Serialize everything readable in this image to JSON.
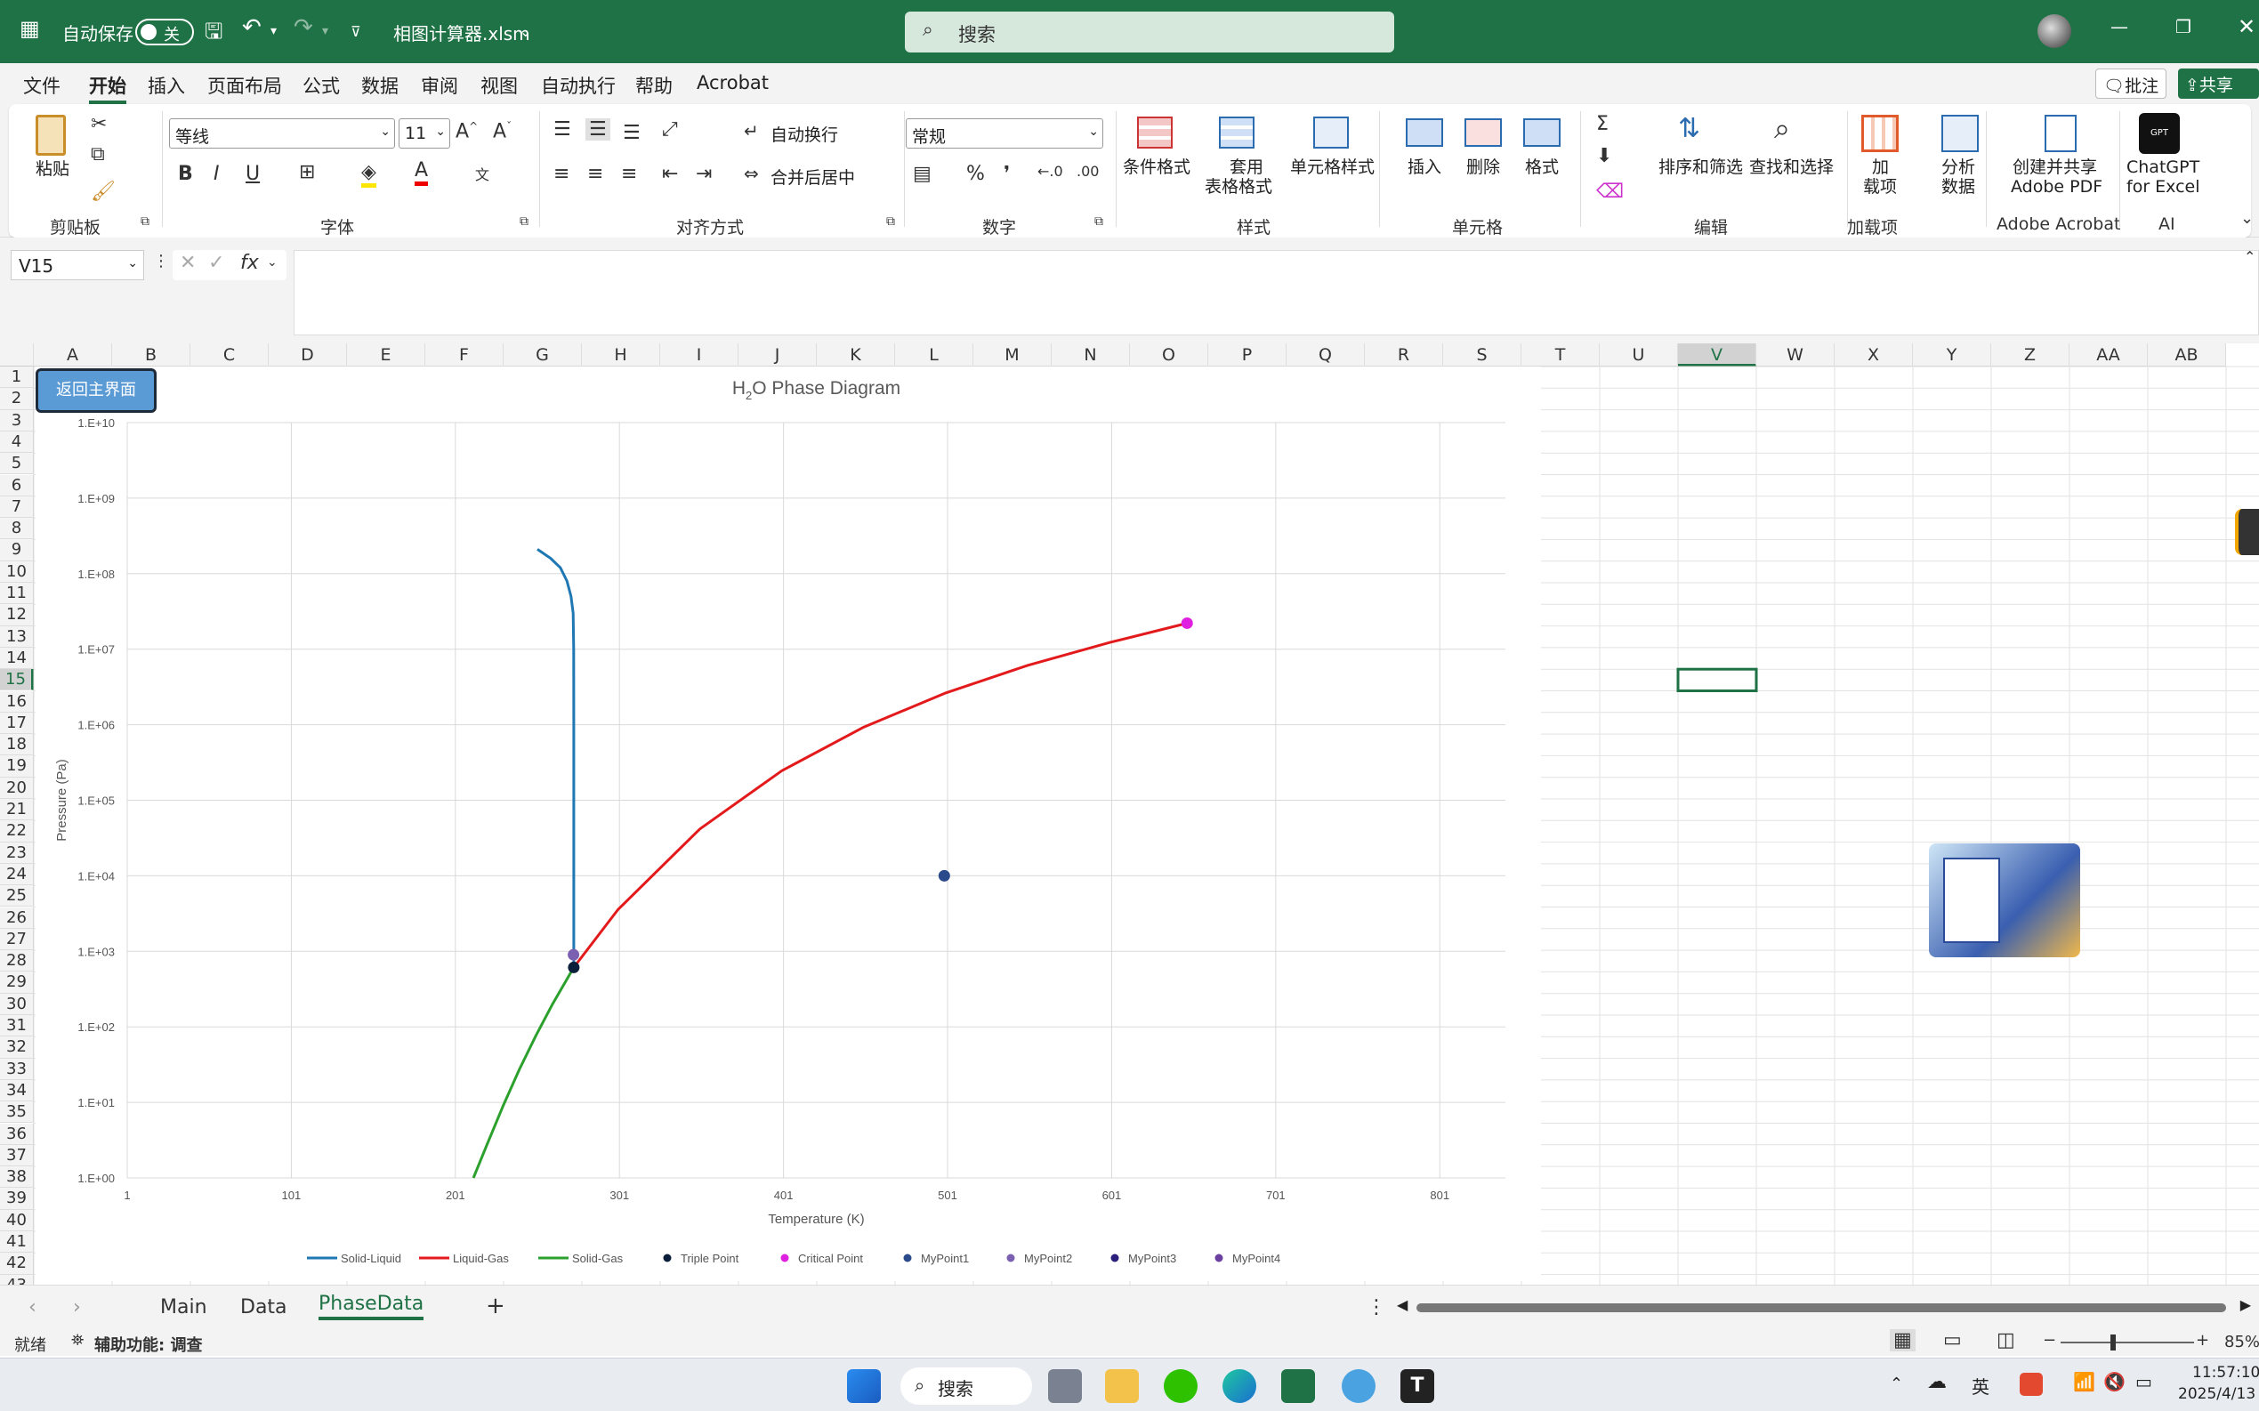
{
  "titlebar": {
    "autosave_label": "自动保存",
    "autosave_state": "关",
    "filename": "相图计算器.xlsm",
    "search_placeholder": "搜索"
  },
  "menu": {
    "items": [
      "文件",
      "开始",
      "插入",
      "页面布局",
      "公式",
      "数据",
      "审阅",
      "视图",
      "自动执行",
      "帮助",
      "Acrobat"
    ],
    "comment_btn": "批注",
    "share_btn": "共享"
  },
  "ribbon": {
    "paste": "粘贴",
    "clipboard": "剪贴板",
    "font_name": "等线",
    "font_size": "11",
    "font_group": "字体",
    "wrap": "自动换行",
    "merge": "合并后居中",
    "align_group": "对齐方式",
    "number_format": "常规",
    "number_group": "数字",
    "cond_format": "条件格式",
    "table_format_1": "套用",
    "table_format_2": "表格格式",
    "cell_style": "单元格样式",
    "styles_group": "样式",
    "insert": "插入",
    "delete": "删除",
    "format": "格式",
    "cells_group": "单元格",
    "sort": "排序和筛选",
    "find": "查找和选择",
    "edit_group": "编辑",
    "addins_1": "加",
    "addins_2": "载项",
    "addins_group": "加载项",
    "analyze_1": "分析",
    "analyze_2": "数据",
    "pdf_1": "创建并共享",
    "pdf_2": "Adobe PDF",
    "acrobat_group": "Adobe Acrobat",
    "gpt_1": "ChatGPT",
    "gpt_2": "for Excel",
    "ai_group": "AI"
  },
  "formula_bar": {
    "name_box": "V15",
    "formula": ""
  },
  "columns": [
    "A",
    "B",
    "C",
    "D",
    "E",
    "F",
    "G",
    "H",
    "I",
    "J",
    "K",
    "L",
    "M",
    "N",
    "O",
    "P",
    "Q",
    "R",
    "S",
    "T",
    "U",
    "V",
    "W",
    "X",
    "Y",
    "Z",
    "AA",
    "AB"
  ],
  "rows": [
    "1",
    "2",
    "3",
    "4",
    "5",
    "6",
    "7",
    "8",
    "9",
    "10",
    "11",
    "12",
    "13",
    "14",
    "15",
    "16",
    "17",
    "18",
    "19",
    "20",
    "21",
    "22",
    "23",
    "24",
    "25",
    "26",
    "27",
    "28",
    "29",
    "30",
    "31",
    "32",
    "33",
    "34",
    "35",
    "36",
    "37",
    "38",
    "39",
    "40",
    "41",
    "42",
    "43"
  ],
  "selected_cell": "V15",
  "back_button": "返回主界面",
  "chart_data": {
    "type": "scatter",
    "title_main": "H",
    "title_sub": "2",
    "title_rest": "O Phase Diagram",
    "xlabel": "Temperature (K)",
    "ylabel": "Pressure (Pa)",
    "xlim": [
      1,
      841
    ],
    "ylim_log10": [
      0,
      10
    ],
    "yscale": "log",
    "xticks": [
      "1",
      "101",
      "201",
      "301",
      "401",
      "501",
      "601",
      "701",
      "801"
    ],
    "yticks": [
      "1.E+00",
      "1.E+01",
      "1.E+02",
      "1.E+03",
      "1.E+04",
      "1.E+05",
      "1.E+06",
      "1.E+07",
      "1.E+08",
      "1.E+09",
      "1.E+10"
    ],
    "legend_position": "bottom",
    "series": [
      {
        "name": "Solid-Liquid",
        "color": "#1f77b4",
        "x": [
          273.16,
          273.16,
          273.1,
          272.8,
          271.5,
          269,
          265,
          259,
          251
        ],
        "y": [
          611.7,
          1000000.0,
          10000000.0,
          30000000.0,
          50000000.0,
          80000000.0,
          120000000.0,
          160000000.0,
          210000000.0
        ]
      },
      {
        "name": "Liquid-Gas",
        "color": "#e31a1c",
        "x": [
          273.16,
          300,
          350,
          400,
          450,
          500,
          550,
          600,
          647
        ],
        "y": [
          611.7,
          3550,
          41700,
          246000,
          932000,
          2640000,
          6120000,
          12300000,
          22100000
        ]
      },
      {
        "name": "Solid-Gas",
        "color": "#2ca02c",
        "x": [
          212,
          220,
          230,
          240,
          250,
          260,
          273.16
        ],
        "y": [
          1,
          2.66,
          8.9,
          27.3,
          76,
          196,
          611.7
        ]
      },
      {
        "name": "Triple Point",
        "color": "#0b1f3a",
        "x": [
          273.16
        ],
        "y": [
          611.7
        ]
      },
      {
        "name": "Critical Point",
        "color": "#e020e0",
        "x": [
          647
        ],
        "y": [
          22100000
        ]
      },
      {
        "name": "MyPoint1",
        "color": "#2b4a8c",
        "x": [
          499
        ],
        "y": [
          10000
        ]
      },
      {
        "name": "MyPoint2",
        "color": "#7b5fb0",
        "x": [
          273
        ],
        "y": [
          900
        ]
      },
      {
        "name": "MyPoint3",
        "color": "#2a1f7a",
        "x": [],
        "y": []
      },
      {
        "name": "MyPoint4",
        "color": "#6a3fa0",
        "x": [],
        "y": []
      }
    ]
  },
  "sheets": [
    "Main",
    "Data",
    "PhaseData"
  ],
  "active_sheet": "PhaseData",
  "status": {
    "ready": "就绪",
    "accessibility": "辅助功能: 调查",
    "zoom": "85%"
  },
  "taskbar": {
    "search": "搜索",
    "ime": "英",
    "time": "11:57:10",
    "date": "2025/4/13"
  }
}
